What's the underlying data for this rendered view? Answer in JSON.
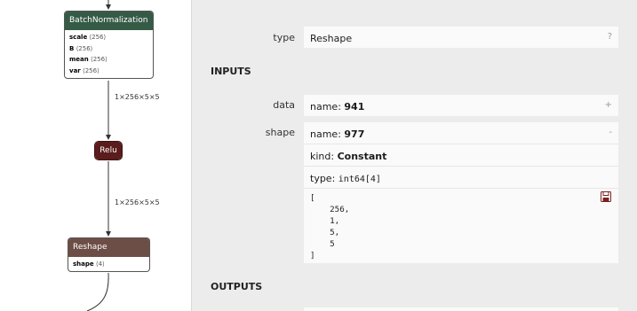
{
  "graph": {
    "batchnorm": {
      "title": "BatchNormalization",
      "attrs": [
        {
          "name": "scale",
          "value": "⟨256⟩"
        },
        {
          "name": "B",
          "value": "⟨256⟩"
        },
        {
          "name": "mean",
          "value": "⟨256⟩"
        },
        {
          "name": "var",
          "value": "⟨256⟩"
        }
      ]
    },
    "edge1_label": "1×256×5×5",
    "relu": {
      "title": "Relu"
    },
    "edge2_label": "1×256×5×5",
    "reshape": {
      "title": "Reshape",
      "attrs": [
        {
          "name": "shape",
          "value": "⟨4⟩"
        }
      ]
    }
  },
  "panel": {
    "type_label": "type",
    "type_value": "Reshape",
    "type_help": "?",
    "inputs_title": "INPUTS",
    "data_label": "data",
    "data_name_key": "name: ",
    "data_name_value": "941",
    "data_expand": "+",
    "shape_label": "shape",
    "shape_name_key": "name: ",
    "shape_name_value": "977",
    "shape_collapse": "-",
    "shape_kind_key": "kind: ",
    "shape_kind_value": "Constant",
    "shape_type_key": "type: ",
    "shape_type_value": "int64[4]",
    "shape_tensor_value": "[\n    256,\n    1,\n    5,\n    5\n]",
    "outputs_title": "OUTPUTS"
  }
}
